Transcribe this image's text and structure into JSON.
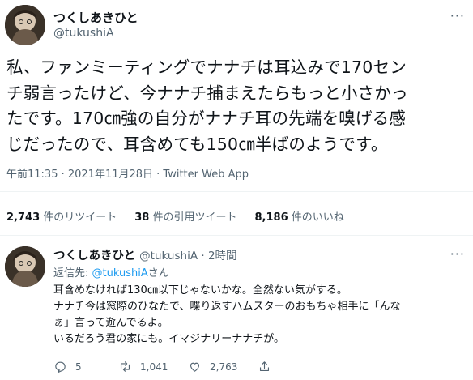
{
  "main_tweet": {
    "display_name": "つくしあきひと",
    "handle": "@tukushiA",
    "more_icon": "more-dots-icon",
    "text_lines": [
      "私、ファンミーティングでナナチは耳込みで170セン",
      "チ弱言ったけど、今ナナチ捕まえたらもっと小さかっ",
      "たです。170㎝強の自分がナナチ耳の先端を嗅げる感",
      "じだったので、耳含めても150㎝半ばのようです。"
    ],
    "meta": "午前11:35 · 2021年11月28日 · Twitter Web App",
    "stats": {
      "retweets_count": "2,743",
      "retweets_label": " 件のリツイート",
      "quotes_count": "38",
      "quotes_label": " 件の引用ツイート",
      "likes_count": "8,186",
      "likes_label": " 件のいいね"
    }
  },
  "reply_tweet": {
    "display_name": "つくしあきひと",
    "handle": "@tukushiA",
    "dot": " · ",
    "time": "2時間",
    "replying_prefix": "返信先: ",
    "replying_mention": "@tukushiA",
    "replying_suffix": "さん",
    "text_lines": [
      "耳含めなければ130㎝以下じゃないかな。全然ない気がする。",
      "ナナチ今は窓際のひなたで、喋り返すハムスターのおもちゃ相手に「んな",
      "ぁ」言って遊んでるよ。",
      "いるだろう君の家にも。イマジナリーナナチが。"
    ],
    "actions": {
      "reply_icon": "reply-icon",
      "reply_count": "5",
      "retweet_icon": "retweet-icon",
      "retweet_count": "1,041",
      "like_icon": "heart-icon",
      "like_count": "2,763",
      "share_icon": "share-icon"
    }
  },
  "colors": {
    "text": "#0f1419",
    "secondary": "#536471",
    "link": "#1d9bf0",
    "divider": "#eff3f4"
  }
}
